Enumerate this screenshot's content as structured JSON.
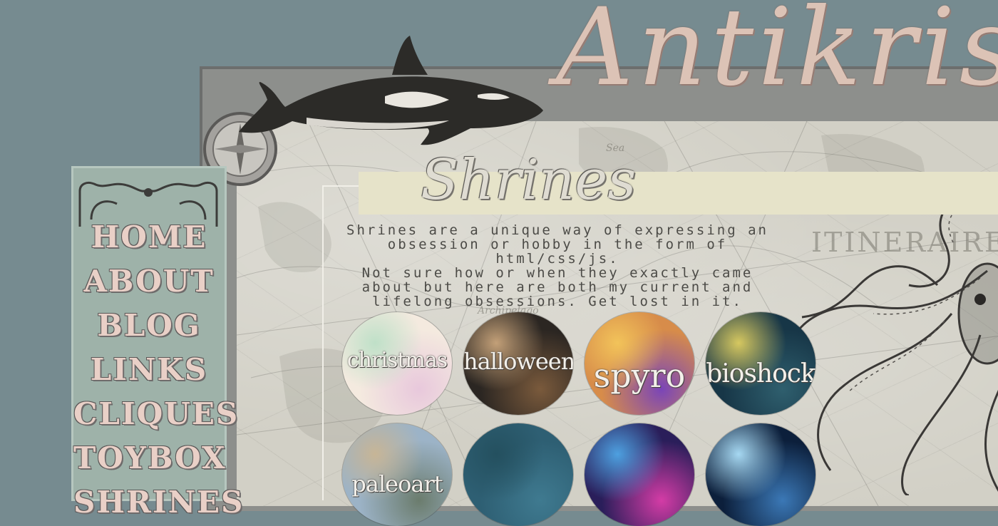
{
  "site": {
    "title": "Antikris"
  },
  "nav": {
    "items": [
      {
        "label": "HOME"
      },
      {
        "label": "ABOUT"
      },
      {
        "label": "BLOG"
      },
      {
        "label": "LINKS"
      },
      {
        "label": "CLIQUES"
      },
      {
        "label": "TOYBOX"
      },
      {
        "label": "SHRINES"
      }
    ]
  },
  "main": {
    "heading": "Shrines",
    "intro_lines": [
      "Shrines are a unique way of expressing an",
      "obsession or hobby in the form of html/css/js.",
      "Not sure how or when they exactly came",
      "about but here are both my current and",
      "lifelong obsessions. Get lost in it."
    ]
  },
  "shrines": [
    {
      "label": "christmas",
      "colors": [
        "#f4eadf",
        "#e8c8dc",
        "#bfe0c8"
      ]
    },
    {
      "label": "halloween",
      "colors": [
        "#2b2622",
        "#7a5a3c",
        "#c3a078"
      ]
    },
    {
      "label": "spyro",
      "colors": [
        "#d78c4a",
        "#7a45b8",
        "#f2c35a"
      ]
    },
    {
      "label": "bioshock",
      "colors": [
        "#173647",
        "#2f5f6e",
        "#d6c860"
      ]
    },
    {
      "label": "paleoart",
      "colors": [
        "#9cb3c7",
        "#6b7c6d",
        "#c7b596"
      ]
    },
    {
      "label": "",
      "colors": [
        "#2e5f73",
        "#3f7a90",
        "#24505f"
      ]
    },
    {
      "label": "",
      "colors": [
        "#2a1e5a",
        "#d43ca6",
        "#4ea0e0"
      ]
    },
    {
      "label": "",
      "colors": [
        "#0c1f3b",
        "#3b78b6",
        "#a6d8f2"
      ]
    }
  ],
  "map_labels": [
    "ITINERAIRE",
    "Archipelago",
    "Sea"
  ]
}
